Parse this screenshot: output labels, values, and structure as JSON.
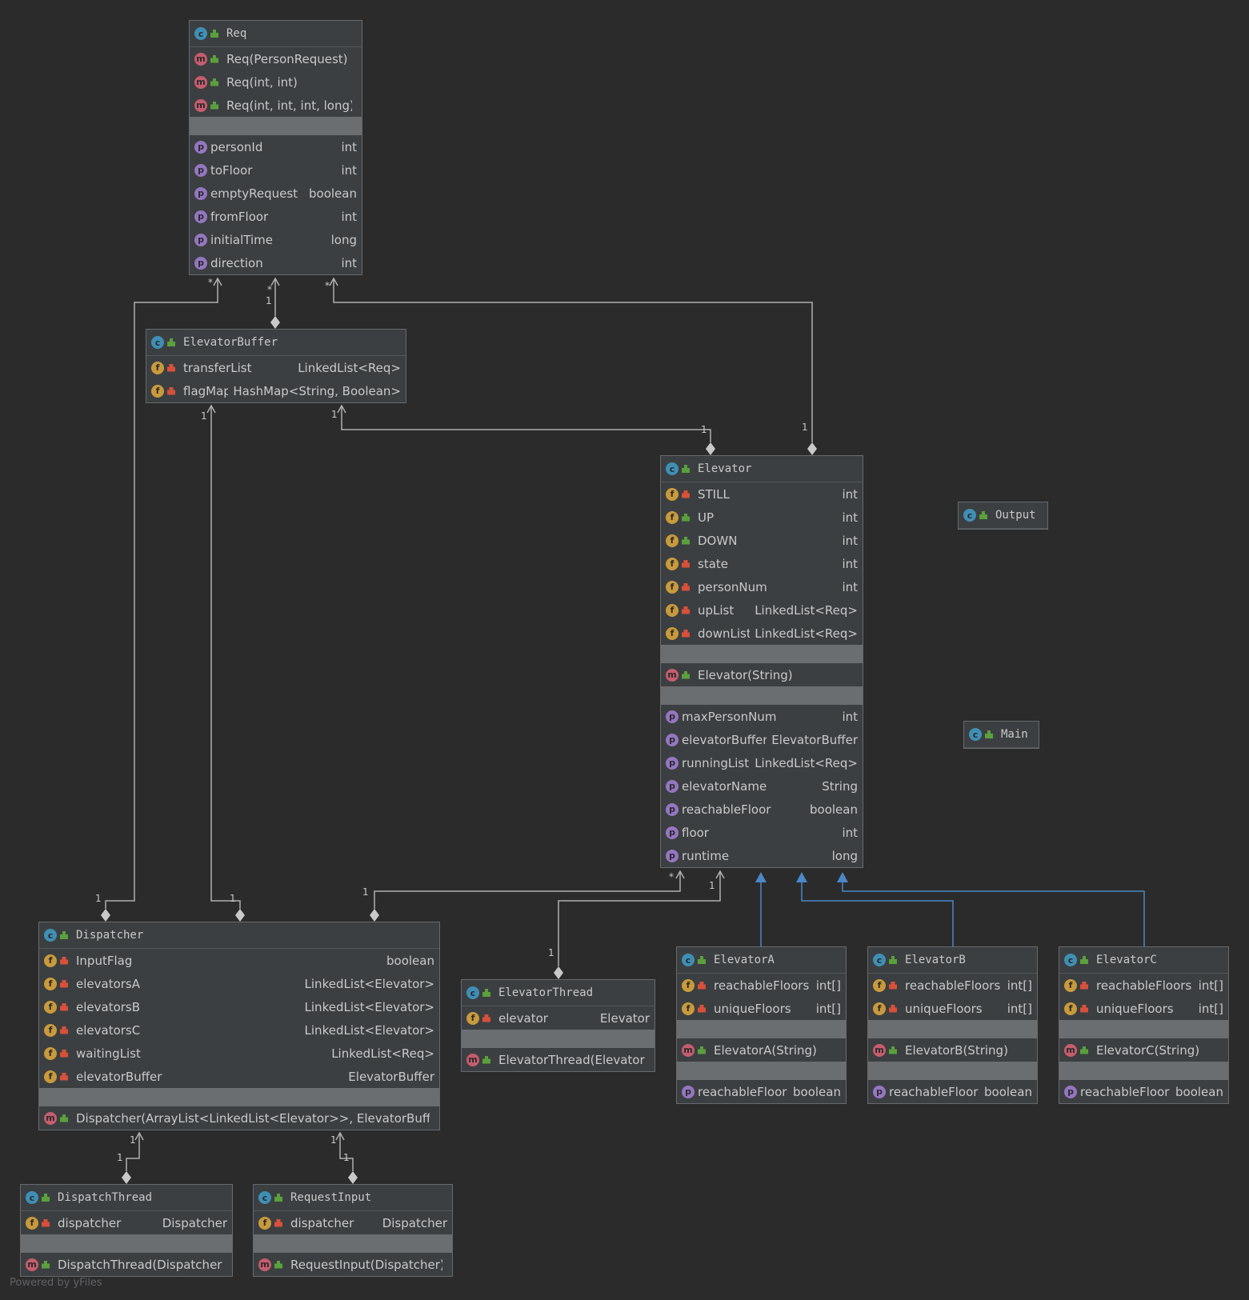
{
  "classes": [
    {
      "name": "Req",
      "sections": [
        [
          {
            "kind": "m",
            "vis": "pub",
            "name": "Req(PersonRequest)",
            "type": ""
          },
          {
            "kind": "m",
            "vis": "pub",
            "name": "Req(int, int)",
            "type": ""
          },
          {
            "kind": "m",
            "vis": "pub",
            "name": "Req(int, int, int, long)",
            "type": ""
          }
        ],
        [
          {
            "kind": "p",
            "vis": "none",
            "name": "personId",
            "type": "int"
          },
          {
            "kind": "p",
            "vis": "none",
            "name": "toFloor",
            "type": "int"
          },
          {
            "kind": "p",
            "vis": "none",
            "name": "emptyRequest",
            "type": "boolean"
          },
          {
            "kind": "p",
            "vis": "none",
            "name": "fromFloor",
            "type": "int"
          },
          {
            "kind": "p",
            "vis": "none",
            "name": "initialTime",
            "type": "long"
          },
          {
            "kind": "p",
            "vis": "none",
            "name": "direction",
            "type": "int"
          }
        ]
      ]
    },
    {
      "name": "ElevatorBuffer",
      "sections": [
        [
          {
            "kind": "f",
            "vis": "pri",
            "name": "transferList",
            "type": "LinkedList<Req>"
          },
          {
            "kind": "f",
            "vis": "pri",
            "name": "flagMap",
            "type": "HashMap<String, Boolean>"
          }
        ]
      ]
    },
    {
      "name": "Elevator",
      "sections": [
        [
          {
            "kind": "f",
            "vis": "pri",
            "name": "STILL",
            "type": "int"
          },
          {
            "kind": "f",
            "vis": "pub",
            "name": "UP",
            "type": "int"
          },
          {
            "kind": "f",
            "vis": "pub",
            "name": "DOWN",
            "type": "int"
          },
          {
            "kind": "f",
            "vis": "pri",
            "name": "state",
            "type": "int"
          },
          {
            "kind": "f",
            "vis": "pri",
            "name": "personNum",
            "type": "int"
          },
          {
            "kind": "f",
            "vis": "pri",
            "name": "upList",
            "type": "LinkedList<Req>"
          },
          {
            "kind": "f",
            "vis": "pri",
            "name": "downList",
            "type": "LinkedList<Req>"
          }
        ],
        [
          {
            "kind": "m",
            "vis": "pub",
            "name": "Elevator(String)",
            "type": ""
          }
        ],
        [
          {
            "kind": "p",
            "vis": "none",
            "name": "maxPersonNum",
            "type": "int"
          },
          {
            "kind": "p",
            "vis": "none",
            "name": "elevatorBuffer",
            "type": "ElevatorBuffer"
          },
          {
            "kind": "p",
            "vis": "none",
            "name": "runningList",
            "type": "LinkedList<Req>"
          },
          {
            "kind": "p",
            "vis": "none",
            "name": "elevatorName",
            "type": "String"
          },
          {
            "kind": "p",
            "vis": "none",
            "name": "reachableFloor",
            "type": "boolean"
          },
          {
            "kind": "p",
            "vis": "none",
            "name": "floor",
            "type": "int"
          },
          {
            "kind": "p",
            "vis": "none",
            "name": "runtime",
            "type": "long"
          }
        ]
      ]
    },
    {
      "name": "Output",
      "sections": []
    },
    {
      "name": "Main",
      "sections": []
    },
    {
      "name": "Dispatcher",
      "sections": [
        [
          {
            "kind": "f",
            "vis": "pri",
            "name": "InputFlag",
            "type": "boolean"
          },
          {
            "kind": "f",
            "vis": "pri",
            "name": "elevatorsA",
            "type": "LinkedList<Elevator>"
          },
          {
            "kind": "f",
            "vis": "pri",
            "name": "elevatorsB",
            "type": "LinkedList<Elevator>"
          },
          {
            "kind": "f",
            "vis": "pri",
            "name": "elevatorsC",
            "type": "LinkedList<Elevator>"
          },
          {
            "kind": "f",
            "vis": "pri",
            "name": "waitingList",
            "type": "LinkedList<Req>"
          },
          {
            "kind": "f",
            "vis": "pri",
            "name": "elevatorBuffer",
            "type": "ElevatorBuffer"
          }
        ],
        [
          {
            "kind": "m",
            "vis": "pub",
            "name": "Dispatcher(ArrayList<LinkedList<Elevator>>, ElevatorBuffer)",
            "type": ""
          }
        ]
      ]
    },
    {
      "name": "ElevatorThread",
      "sections": [
        [
          {
            "kind": "f",
            "vis": "pri",
            "name": "elevator",
            "type": "Elevator"
          }
        ],
        [
          {
            "kind": "m",
            "vis": "pub",
            "name": "ElevatorThread(Elevator)",
            "type": ""
          }
        ]
      ]
    },
    {
      "name": "ElevatorA",
      "sections": [
        [
          {
            "kind": "f",
            "vis": "pri",
            "name": "reachableFloors",
            "type": "int[]"
          },
          {
            "kind": "f",
            "vis": "pri",
            "name": "uniqueFloors",
            "type": "int[]"
          }
        ],
        [
          {
            "kind": "m",
            "vis": "pub",
            "name": "ElevatorA(String)",
            "type": ""
          }
        ],
        [
          {
            "kind": "p",
            "vis": "none",
            "name": "reachableFloor",
            "type": "boolean"
          }
        ]
      ]
    },
    {
      "name": "ElevatorB",
      "sections": [
        [
          {
            "kind": "f",
            "vis": "pri",
            "name": "reachableFloors",
            "type": "int[]"
          },
          {
            "kind": "f",
            "vis": "pri",
            "name": "uniqueFloors",
            "type": "int[]"
          }
        ],
        [
          {
            "kind": "m",
            "vis": "pub",
            "name": "ElevatorB(String)",
            "type": ""
          }
        ],
        [
          {
            "kind": "p",
            "vis": "none",
            "name": "reachableFloor",
            "type": "boolean"
          }
        ]
      ]
    },
    {
      "name": "ElevatorC",
      "sections": [
        [
          {
            "kind": "f",
            "vis": "pri",
            "name": "reachableFloors",
            "type": "int[]"
          },
          {
            "kind": "f",
            "vis": "pri",
            "name": "uniqueFloors",
            "type": "int[]"
          }
        ],
        [
          {
            "kind": "m",
            "vis": "pub",
            "name": "ElevatorC(String)",
            "type": ""
          }
        ],
        [
          {
            "kind": "p",
            "vis": "none",
            "name": "reachableFloor",
            "type": "boolean"
          }
        ]
      ]
    },
    {
      "name": "DispatchThread",
      "sections": [
        [
          {
            "kind": "f",
            "vis": "pri",
            "name": "dispatcher",
            "type": "Dispatcher"
          }
        ],
        [
          {
            "kind": "m",
            "vis": "pub",
            "name": "DispatchThread(Dispatcher)",
            "type": ""
          }
        ]
      ]
    },
    {
      "name": "RequestInput",
      "sections": [
        [
          {
            "kind": "f",
            "vis": "pri",
            "name": "dispatcher",
            "type": "Dispatcher"
          }
        ],
        [
          {
            "kind": "m",
            "vis": "pub",
            "name": "RequestInput(Dispatcher)",
            "type": ""
          }
        ]
      ]
    }
  ],
  "multiplicities": [
    "*",
    "*",
    "1",
    "*",
    "1",
    "1",
    "1",
    "1",
    "1",
    "1",
    "1",
    "*",
    "1",
    "1",
    "1",
    "1",
    "1",
    "1"
  ],
  "watermark": "Powered by yFiles",
  "colors": {
    "background": "#2b2b2b",
    "node": "#3c3f41",
    "edge": "#b0b0b0",
    "inheritance": "#4a88c7"
  }
}
